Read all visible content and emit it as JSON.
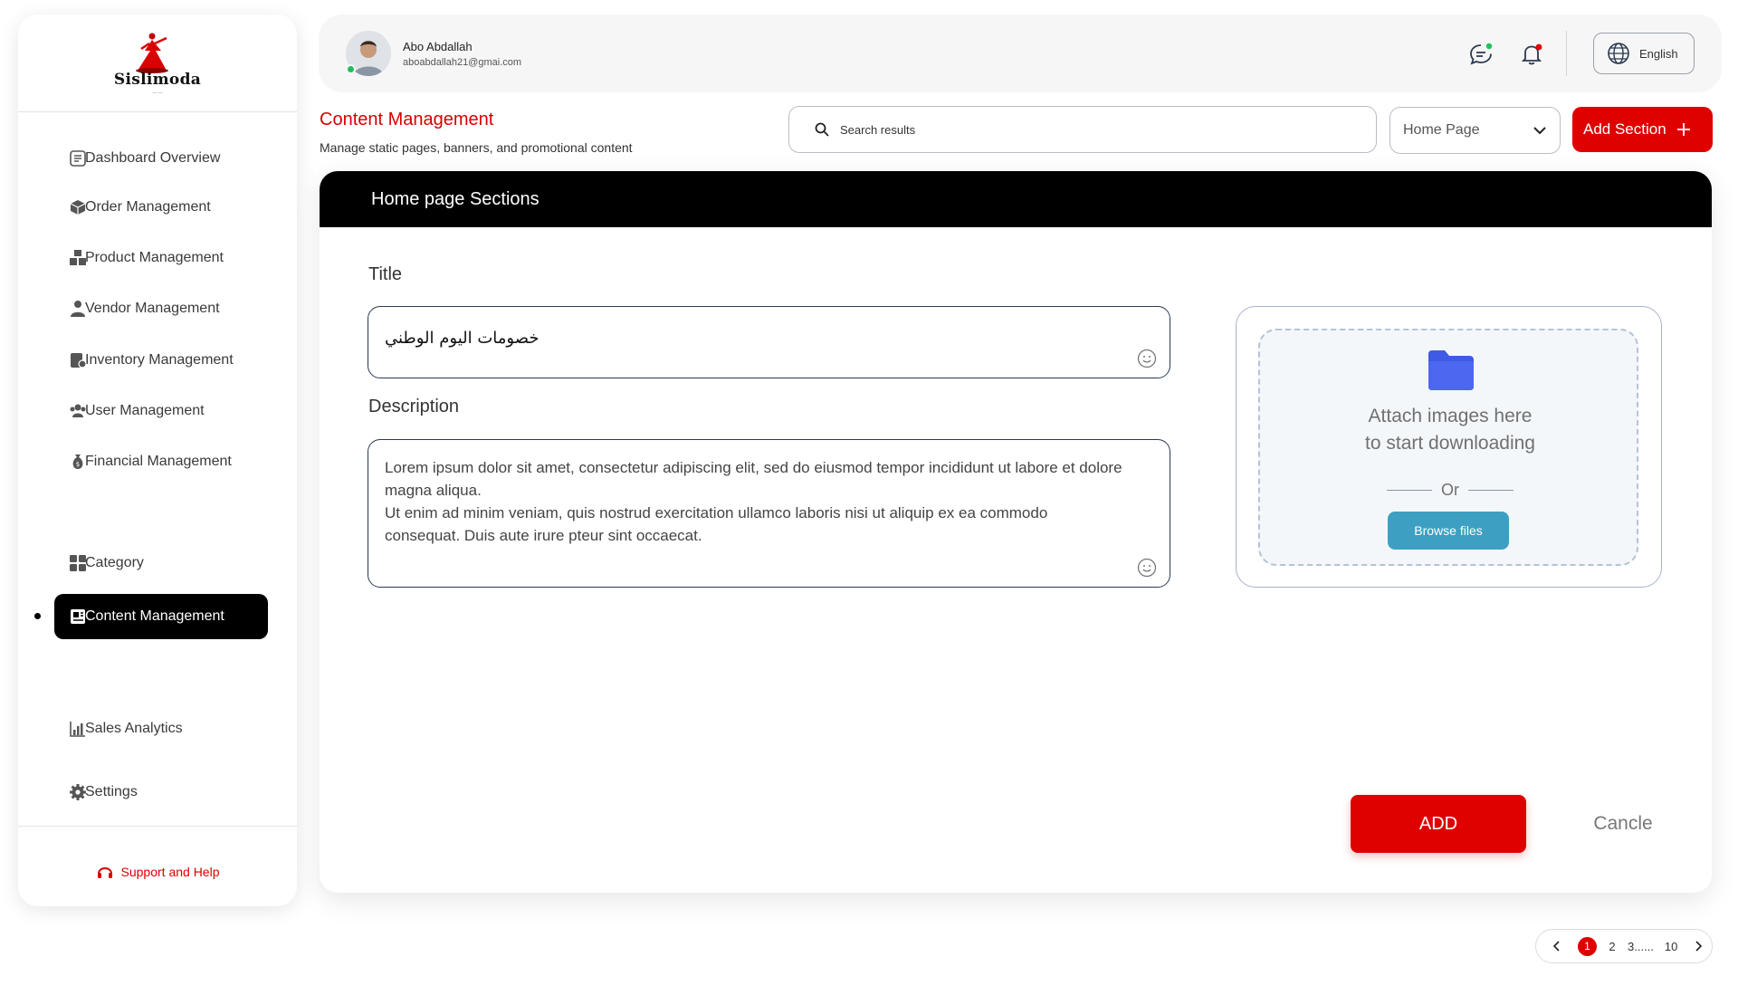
{
  "brand": {
    "name": "Sislimoda"
  },
  "sidebar": {
    "items": [
      {
        "label": "Dashboard Overview",
        "icon": "dashboard-icon"
      },
      {
        "label": "Order Management",
        "icon": "box-icon"
      },
      {
        "label": "Product Management",
        "icon": "boxes-icon"
      },
      {
        "label": "Vendor Management",
        "icon": "vendor-icon"
      },
      {
        "label": "Inventory Management",
        "icon": "inventory-icon"
      },
      {
        "label": "User Management",
        "icon": "users-icon"
      },
      {
        "label": "Financial Management",
        "icon": "money-bag-icon"
      },
      {
        "label": "Content Management",
        "icon": "content-icon",
        "active": true
      },
      {
        "label": "Category",
        "icon": "grid-icon"
      },
      {
        "label": "Sales Analytics",
        "icon": "chart-icon"
      },
      {
        "label": "Settings",
        "icon": "gear-icon"
      }
    ],
    "support_label": "Support and Help"
  },
  "topbar": {
    "user_name": "Abo Abdallah",
    "user_email": "aboabdallah21@gmai.com",
    "language": "English"
  },
  "header": {
    "title": "Content Management",
    "subtitle": "Manage static pages, banners, and promotional content",
    "search_placeholder": "Search results",
    "page_select": "Home Page",
    "add_section_label": "Add Section"
  },
  "panel": {
    "heading": "Home page Sections",
    "title_label": "Title",
    "title_value": "خصومات اليوم الوطني",
    "description_label": "Description",
    "description_value": "Lorem ipsum dolor sit amet, consectetur adipiscing elit, sed do eiusmod tempor incididunt ut labore et dolore magna aliqua.\nUt enim ad minim veniam, quis nostrud exercitation ullamco laboris nisi ut aliquip ex ea commodo consequat. Duis aute irure pteur sint occaecat.",
    "attach_text": "Attach images here\nto start downloading",
    "or_text": "Or",
    "browse_label": "Browse files",
    "add_label": "ADD",
    "cancel_label": "Cancle"
  },
  "pagination": {
    "pages": [
      "1",
      "2",
      "3......",
      "10"
    ],
    "current": "1"
  },
  "colors": {
    "accent": "#df0000",
    "active_nav": "#000000",
    "browse": "#3da0c2",
    "folder": "#3f5be6"
  }
}
